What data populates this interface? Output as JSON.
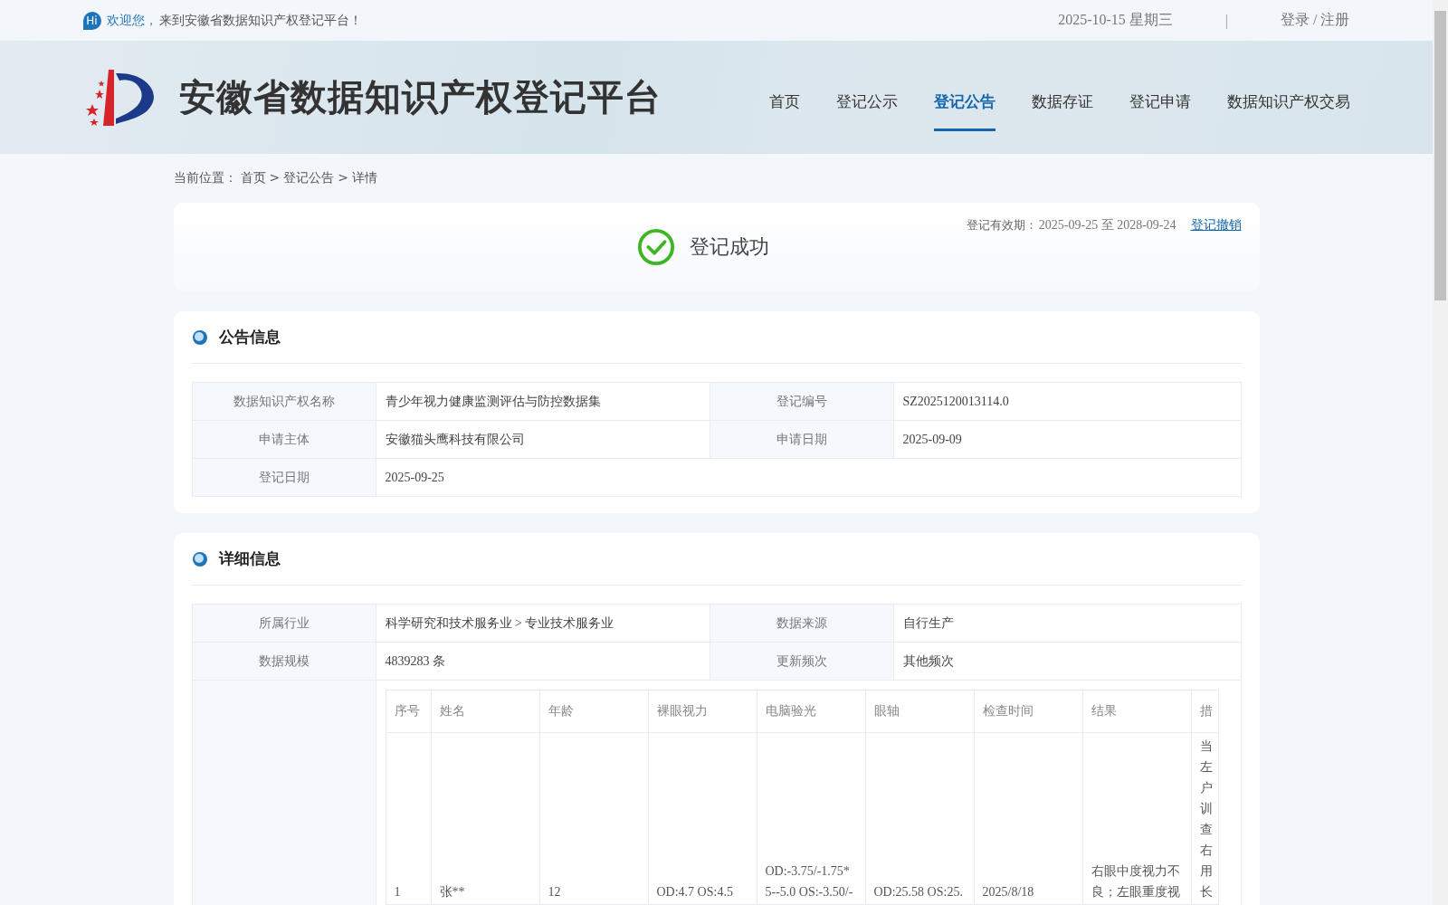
{
  "top_bar": {
    "hi_badge": "Hi",
    "greeting": "欢迎您，",
    "welcome": "来到安徽省数据知识产权登记平台！",
    "date": "2025-10-15 星期三",
    "separator": "|",
    "auth": "登录 / 注册"
  },
  "header": {
    "site_title": "安徽省数据知识产权登记平台",
    "nav": [
      {
        "label": "首页",
        "selected": false
      },
      {
        "label": "登记公示",
        "selected": false
      },
      {
        "label": "登记公告",
        "selected": true
      },
      {
        "label": "数据存证",
        "selected": false
      },
      {
        "label": "登记申请",
        "selected": false
      },
      {
        "label": "数据知识产权交易",
        "selected": false
      }
    ]
  },
  "breadcrumb": {
    "label": "当前位置：",
    "items": [
      "首页",
      "登记公告",
      "详情"
    ],
    "separator": ">"
  },
  "status": {
    "kind": "success",
    "text": "登记成功",
    "validity_label": "登记有效期：",
    "validity": "2025-09-25 至 2028-09-24",
    "revoke_link": "登记撤销"
  },
  "announcement": {
    "title": "公告信息",
    "rows": [
      [
        {
          "label": "数据知识产权名称",
          "value": "青少年视力健康监测评估与防控数据集"
        },
        {
          "label": "登记编号",
          "value": "SZ2025120013114.0"
        }
      ],
      [
        {
          "label": "申请主体",
          "value": "安徽猫头鹰科技有限公司"
        },
        {
          "label": "申请日期",
          "value": "2025-09-09"
        }
      ],
      [
        {
          "label": "登记日期",
          "value": "2025-09-25"
        }
      ]
    ]
  },
  "details": {
    "title": "详细信息",
    "rows": [
      [
        {
          "label": "所属行业",
          "value": "科学研究和技术服务业 > 专业技术服务业"
        },
        {
          "label": "数据来源",
          "value": "自行生产"
        }
      ],
      [
        {
          "label": "数据规模",
          "value": "4839283 条"
        },
        {
          "label": "更新频次",
          "value": "其他频次"
        }
      ]
    ],
    "sample_table": {
      "columns": [
        "序号",
        "姓名",
        "年龄",
        "裸眼视力",
        "电脑验光",
        "眼轴",
        "检查时间",
        "结果",
        "措"
      ],
      "rows": [
        [
          [
            "1"
          ],
          [
            "张**"
          ],
          [
            "12"
          ],
          [
            "OD:4.7 OS:4.5"
          ],
          [
            "OD:-3.75/-1.75*",
            "5--5.0 OS:-3.50/-"
          ],
          [
            "OD:25.58 OS:25."
          ],
          [
            "2025/8/18"
          ],
          [
            "右眼中度视力不",
            "良；左眼重度视"
          ],
          [
            "当",
            "左",
            "户",
            "训",
            "查",
            "右",
            "用",
            "长"
          ]
        ]
      ]
    }
  }
}
